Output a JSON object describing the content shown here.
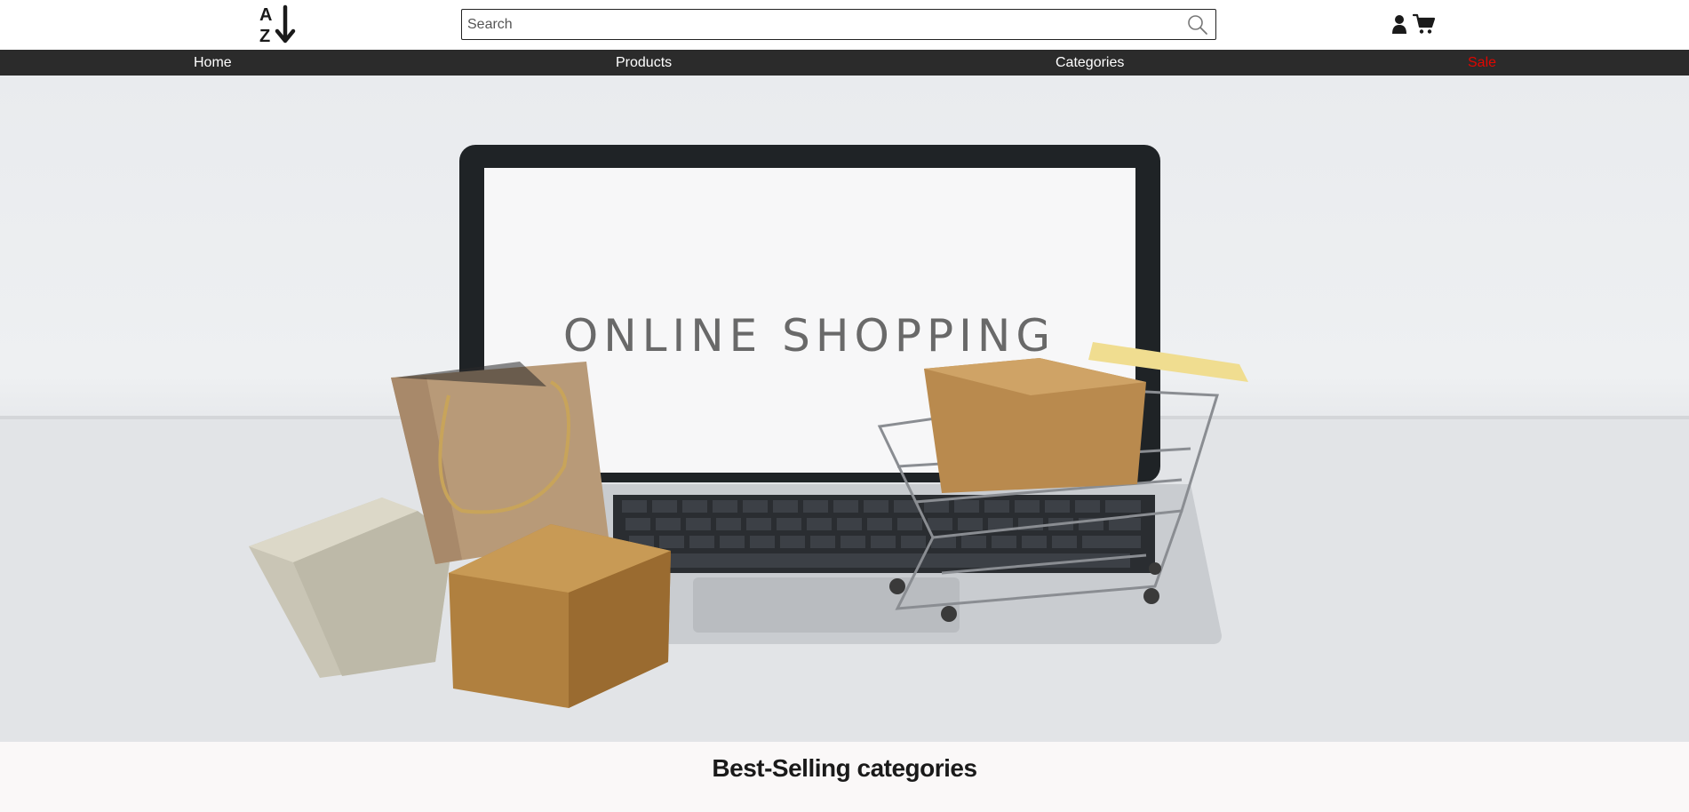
{
  "header": {
    "search": {
      "placeholder": "Search",
      "value": ""
    }
  },
  "nav": {
    "items": [
      {
        "label": "Home"
      },
      {
        "label": "Products"
      },
      {
        "label": "Categories"
      },
      {
        "label": "Sale"
      }
    ]
  },
  "hero": {
    "screen_text": "ONLINE SHOPPING"
  },
  "section": {
    "title": "Best-Selling categories"
  },
  "colors": {
    "nav_background": "#2b2b2b",
    "sale": "#e10600",
    "page_background": "#faf8f8"
  },
  "icons": [
    "az-sort-logo-icon",
    "search-icon",
    "user-icon",
    "cart-icon"
  ]
}
